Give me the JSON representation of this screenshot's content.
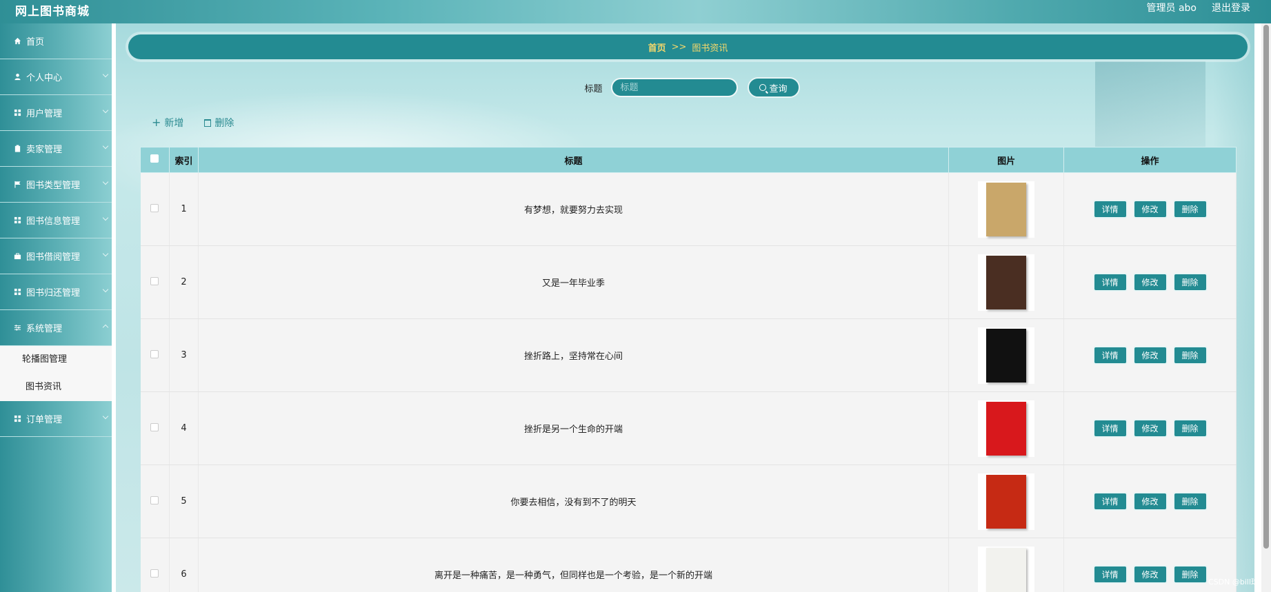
{
  "app": {
    "title": "网上图书商城",
    "user_label": "管理员 abo",
    "logout_label": "退出登录"
  },
  "sidebar": {
    "items": [
      {
        "label": "首页",
        "icon": "home-icon"
      },
      {
        "label": "个人中心",
        "icon": "user-icon"
      },
      {
        "label": "用户管理",
        "icon": "grid-icon"
      },
      {
        "label": "卖家管理",
        "icon": "clipboard-icon"
      },
      {
        "label": "图书类型管理",
        "icon": "flag-icon"
      },
      {
        "label": "图书信息管理",
        "icon": "grid-icon"
      },
      {
        "label": "图书借阅管理",
        "icon": "briefcase-icon"
      },
      {
        "label": "图书归还管理",
        "icon": "grid-icon"
      },
      {
        "label": "系统管理",
        "icon": "sliders-icon"
      }
    ],
    "submenu": [
      {
        "label": "轮播图管理"
      },
      {
        "label": "图书资讯"
      }
    ],
    "last_item": {
      "label": "订单管理",
      "icon": "grid-icon"
    }
  },
  "breadcrumb": {
    "home": "首页",
    "separator": ">>",
    "current": "图书资讯"
  },
  "search": {
    "label": "标题",
    "placeholder": "标题",
    "button_label": "查询"
  },
  "actions": {
    "add_label": "新增",
    "delete_label": "删除"
  },
  "table": {
    "headers": [
      "索引",
      "标题",
      "图片",
      "操作"
    ],
    "rows": [
      {
        "index": "1",
        "title": "有梦想，就要努力去实现",
        "cover_color": "#c9a76a"
      },
      {
        "index": "2",
        "title": "又是一年毕业季",
        "cover_color": "#4a2e22"
      },
      {
        "index": "3",
        "title": "挫折路上，坚持常在心间",
        "cover_color": "#111111"
      },
      {
        "index": "4",
        "title": "挫折是另一个生命的开端",
        "cover_color": "#d8181c"
      },
      {
        "index": "5",
        "title": "你要去相信，没有到不了的明天",
        "cover_color": "#c62a14"
      },
      {
        "index": "6",
        "title": "离开是一种痛苦，是一种勇气，但同样也是一个考验，是一个新的开端",
        "cover_color": "#f2f2ee"
      }
    ],
    "row_buttons": {
      "detail": "详情",
      "edit": "修改",
      "delete": "删除"
    }
  },
  "colors": {
    "primary": "#238b92",
    "header_bg": "#8fd1d6",
    "breadcrumb_text": "#f5d86b"
  },
  "watermark": "CSDN @bill球"
}
